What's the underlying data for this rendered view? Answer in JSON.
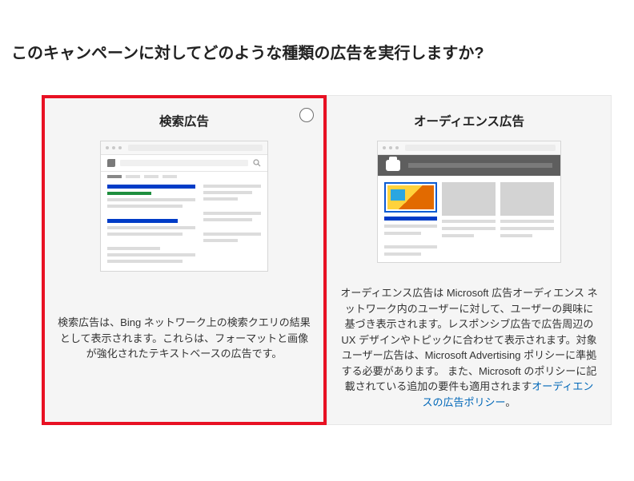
{
  "heading": "このキャンペーンに対してどのような種類の広告を実行しますか?",
  "cards": {
    "search": {
      "title": "検索広告",
      "desc": "検索広告は、Bing ネットワーク上の検索クエリの結果として表示されます。これらは、フォーマットと画像が強化されたテキストベースの広告です。"
    },
    "audience": {
      "title": "オーディエンス広告",
      "desc_prefix": "オーディエンス広告は Microsoft 広告オーディエンス ネットワーク内のユーザーに対して、ユーザーの興味に基づき表示されます。レスポンシブ広告で広告周辺の UX デザインやトピックに合わせて表示されます。対象ユーザー広告は、Microsoft Advertising ポリシーに準拠する必要があります。 また、Microsoft のポリシーに記載されている追加の要件も適用されます",
      "link_text": "オーディエンスの広告ポリシー",
      "desc_suffix": "。"
    }
  }
}
